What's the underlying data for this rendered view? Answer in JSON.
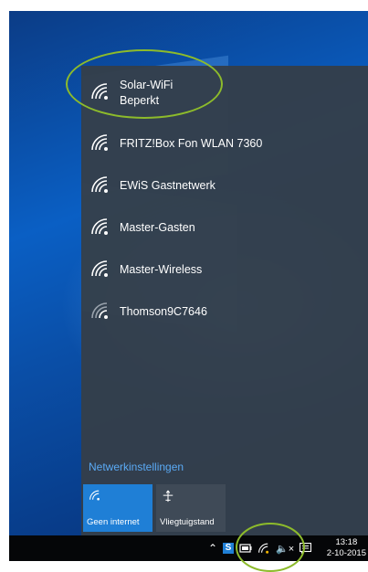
{
  "networks": [
    {
      "name": "Solar-WiFi",
      "status": "Beperkt"
    },
    {
      "name": "FRITZ!Box Fon WLAN 7360"
    },
    {
      "name": "EWiS Gastnetwerk"
    },
    {
      "name": "Master-Gasten"
    },
    {
      "name": "Master-Wireless"
    },
    {
      "name": "Thomson9C7646"
    }
  ],
  "settings_link": "Netwerkinstellingen",
  "quick_actions": [
    {
      "label": "Geen internet",
      "icon": "wifi-icon",
      "active": true
    },
    {
      "label": "Vliegtuigstand",
      "icon": "airplane-icon",
      "active": false
    }
  ],
  "taskbar": {
    "time": "13:18",
    "date": "2-10-2015",
    "icons": [
      "chevron-up-icon",
      "s-app-icon",
      "battery-icon",
      "wifi-icon",
      "speaker-muted-icon",
      "action-center-icon"
    ]
  },
  "colors": {
    "flyout_bg": "#343e4a",
    "accent": "#1f7fd6",
    "link": "#5aaaf5",
    "highlight_ring": "#8dbb2b"
  }
}
